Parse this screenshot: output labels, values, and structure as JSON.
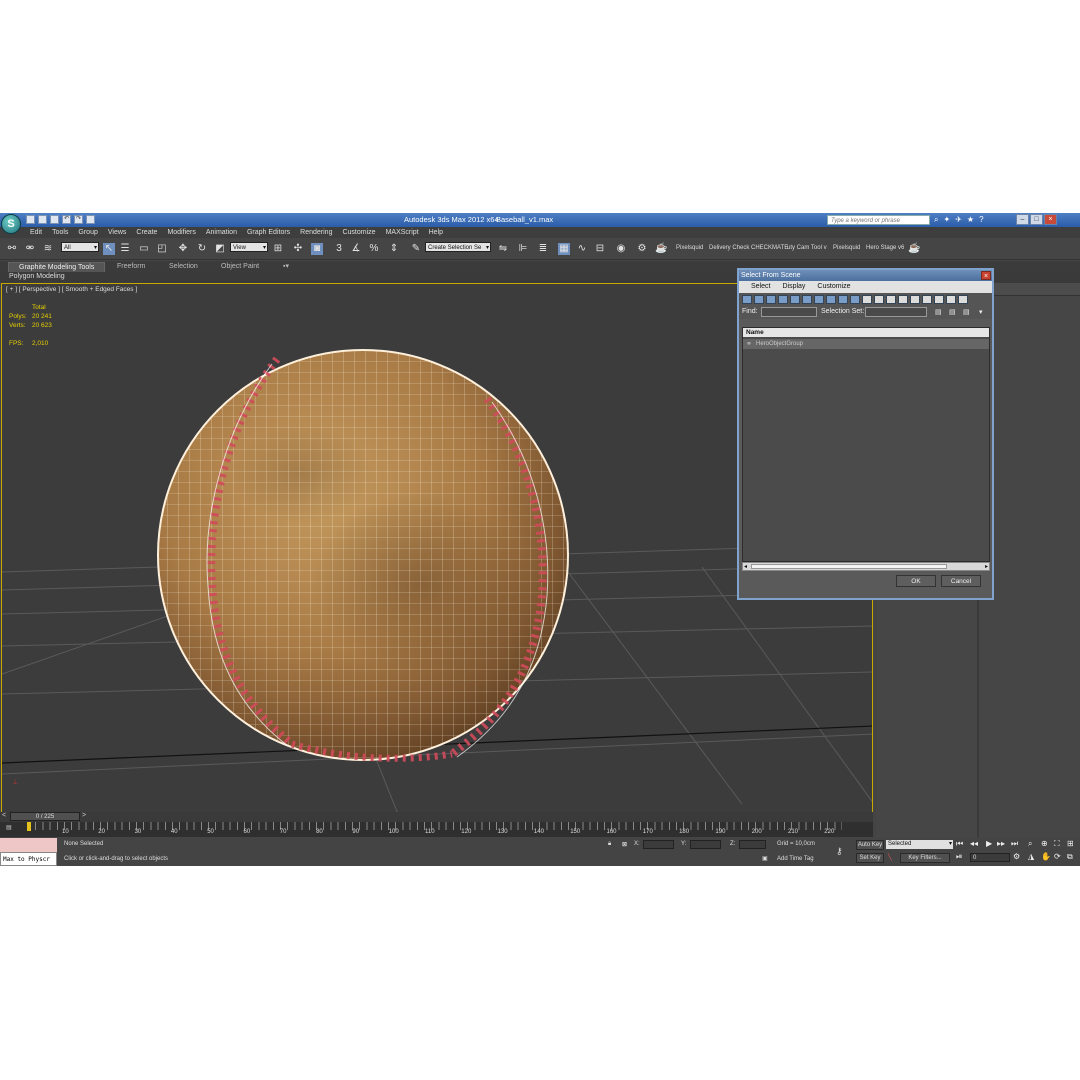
{
  "window": {
    "app_title": "Autodesk 3ds Max  2012 x64",
    "file_name": "Baseball_v1.max",
    "search_placeholder": "Type a keyword or phrase",
    "logo_glyph": "S"
  },
  "menu": [
    "Edit",
    "Tools",
    "Group",
    "Views",
    "Create",
    "Modifiers",
    "Animation",
    "Graph Editors",
    "Rendering",
    "Customize",
    "MAXScript",
    "Help"
  ],
  "toolbar": {
    "filter_value": "All",
    "coord_value": "View",
    "named_selection": "Create Selection Se",
    "snap_angle": "3",
    "labels": [
      "Pixelsquid",
      "Delivery Check",
      "CHECKMATE",
      "uty Cam Tool v",
      "Pixelsquid",
      "Hero Stage v6"
    ]
  },
  "ribbon": {
    "tabs": [
      "Graphite Modeling Tools",
      "Freeform",
      "Selection",
      "Object Paint"
    ],
    "panel": "Polygon Modeling"
  },
  "viewport": {
    "label": "[ + ] [ Perspective ] [ Smooth + Edged Faces ]",
    "total_label": "Total",
    "polys_label": "Polys:",
    "polys_value": "20 241",
    "verts_label": "Verts:",
    "verts_value": "20 623",
    "fps_label": "FPS:",
    "fps_value": "2,010"
  },
  "dialog": {
    "title": "Select From Scene",
    "menu": [
      "Select",
      "Display",
      "Customize"
    ],
    "find_label": "Find:",
    "selection_set_label": "Selection Set:",
    "column_name": "Name",
    "items": [
      "HeroObjectGroup"
    ],
    "ok_label": "OK",
    "cancel_label": "Cancel"
  },
  "timeline": {
    "frame_display": "0 / 225",
    "ticks": [
      "10",
      "20",
      "30",
      "40",
      "50",
      "60",
      "70",
      "80",
      "90",
      "100",
      "110",
      "120",
      "130",
      "140",
      "150",
      "160",
      "170",
      "180",
      "190",
      "200",
      "210",
      "220"
    ]
  },
  "status": {
    "maxscript_text": "Max to Physcr",
    "selection_text": "None Selected",
    "prompt_text": "Click or click-and-drag to select objects",
    "x_label": "X:",
    "y_label": "Y:",
    "z_label": "Z:",
    "grid_text": "Grid = 10,0cm",
    "add_time_tag": "Add Time Tag",
    "auto_key": "Auto Key",
    "set_key": "Set Key",
    "key_mode_value": "Selected",
    "key_filters": "Key Filters...",
    "current_frame": "0"
  },
  "colors": {
    "viewport_border": "#c9a900",
    "stats_text": "#e8d000",
    "title_bar": "#3a6bb5",
    "baseball_leather": "#a87a45",
    "stitches": "#d04a5a"
  }
}
